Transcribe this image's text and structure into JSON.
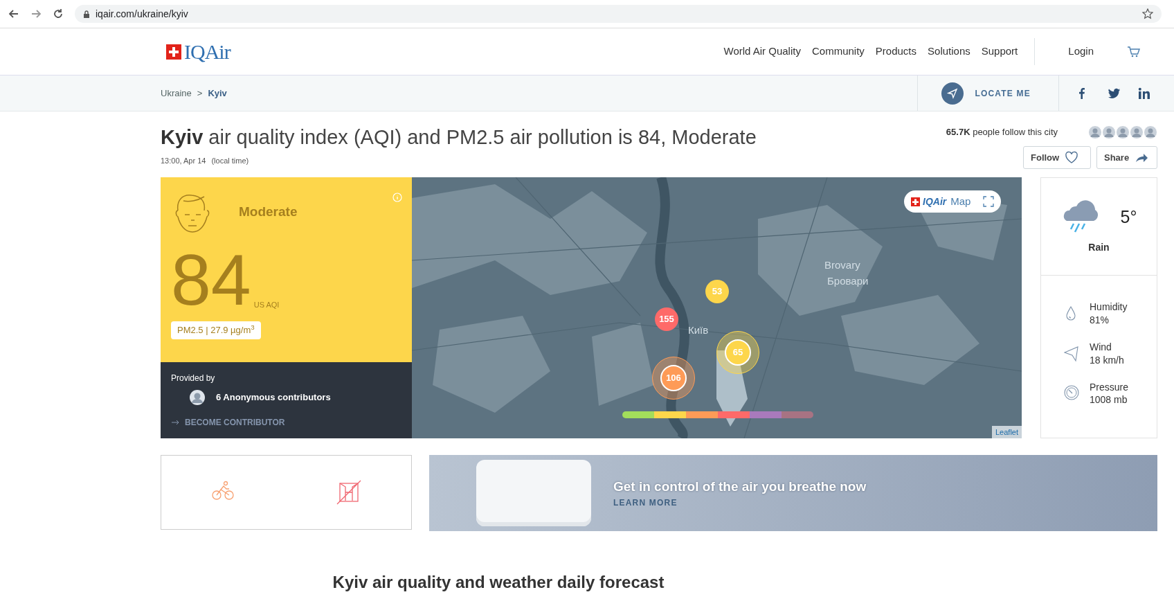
{
  "browser": {
    "url": "iqair.com/ukraine/kyiv"
  },
  "header": {
    "logo": "IQAir",
    "nav": [
      "World Air Quality",
      "Community",
      "Products",
      "Solutions",
      "Support"
    ],
    "login": "Login"
  },
  "breadcrumb": {
    "items": [
      {
        "label": "Ukraine",
        "current": false
      },
      {
        "label": "Kyiv",
        "current": true
      }
    ],
    "separator": ">",
    "locate": "LOCATE ME",
    "social": [
      {
        "kind": "facebook"
      },
      {
        "kind": "twitter"
      },
      {
        "kind": "linkedin"
      }
    ]
  },
  "title": "**Kyiv** air quality index (AQI) and PM2.5 air pollution is 84, Moderate",
  "time": "13:00, Apr 14",
  "time_note": "(local time)",
  "followers": "**65.7K** people follow this city",
  "buttons": [
    {
      "label": "Follow",
      "kind": "follow"
    },
    {
      "label": "Share",
      "kind": "share"
    }
  ],
  "aqi": {
    "status": "Moderate",
    "value": "84",
    "unit": "US AQI",
    "pollutant": "PM2.5 | 27.9 µg/m$^{3}$"
  },
  "provider": {
    "heading": "Provided by",
    "name": "6 Anonymous contributors",
    "link": "BECOME CONTRIBUTOR"
  },
  "map": {
    "logo": "IQAir",
    "badge": "Map",
    "labels": [
      "Brovary",
      "Бровари",
      "Київ"
    ],
    "markers": [
      {
        "value": "53",
        "color": "#fdd64b",
        "kind": "single"
      },
      {
        "value": "155",
        "color": "#fe6a69",
        "kind": "single"
      },
      {
        "value": "65",
        "color": "#fdd64b",
        "kind": "cluster"
      },
      {
        "value": "106",
        "color": "#fe9b57",
        "kind": "cluster"
      }
    ],
    "attribution": "Leaflet"
  },
  "weather": {
    "temperature": "5°",
    "condition": "Rain",
    "details": [
      {
        "kind": "humidity",
        "label": "Humidity",
        "value": "81%"
      },
      {
        "kind": "wind",
        "label": "Wind",
        "value": "18 km/h"
      },
      {
        "kind": "pressure",
        "label": "Pressure",
        "value": "1008 mb"
      }
    ]
  },
  "recommendations": [
    {
      "kind": "cycling"
    },
    {
      "kind": "window"
    }
  ],
  "promo": {
    "headline": "Get in control of the air you breathe now",
    "link": "LEARN MORE"
  },
  "forecast_heading": "Kyiv air quality and weather daily forecast"
}
